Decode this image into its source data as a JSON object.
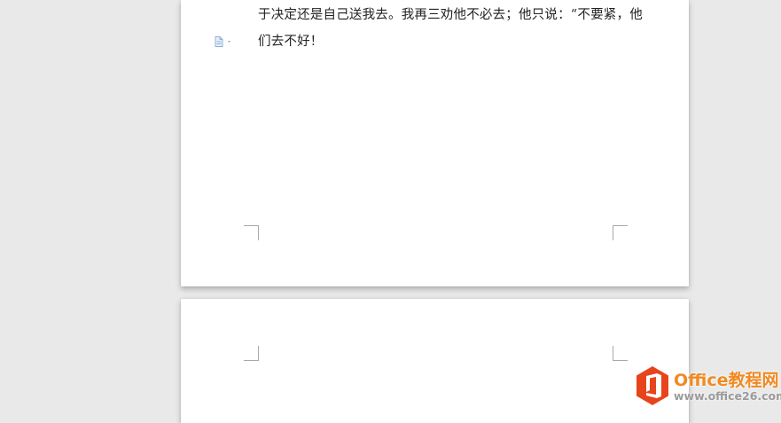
{
  "document": {
    "pages": [
      {
        "lines": [
          "于决定还是自己送我去。我再三劝他不必去；他只说：“不要紧，他",
          "们去不好！"
        ]
      },
      {
        "lines": []
      }
    ],
    "paragraph_icon": "paragraph-options-icon"
  },
  "watermark": {
    "title": "Office教程网",
    "url": "www.office26.com",
    "logo_icon": "office-logo-icon"
  },
  "colors": {
    "canvas": "#e9e9e9",
    "page": "#ffffff",
    "text": "#222222",
    "corner_marks": "#a9a9a9",
    "icon_blue": "#8fb0d8",
    "watermark_orange": "#f08a24",
    "logo_red": "#e8441c",
    "watermark_gray": "#9a9a9a"
  }
}
